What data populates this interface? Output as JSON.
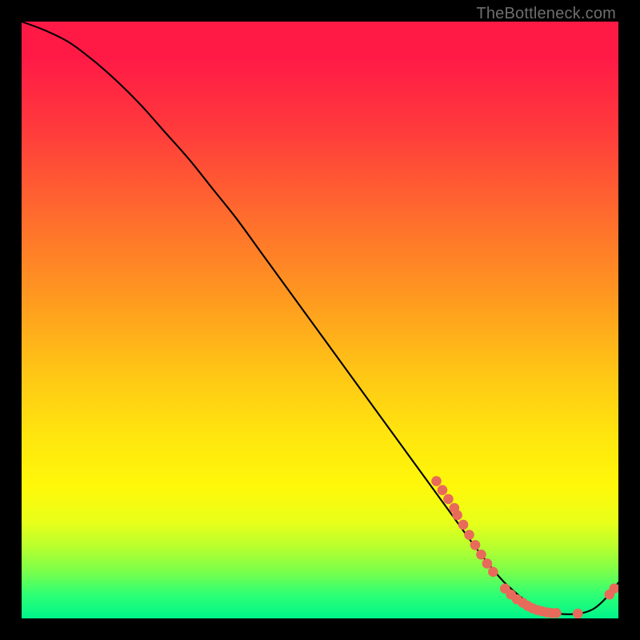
{
  "watermark": "TheBottleneck.com",
  "colors": {
    "background": "#000000",
    "curve": "#000000",
    "marker": "#e86a5a",
    "gradient_top": "#ff1a46",
    "gradient_bottom": "#00f58a"
  },
  "chart_data": {
    "type": "line",
    "title": "",
    "xlabel": "",
    "ylabel": "",
    "xlim": [
      0,
      100
    ],
    "ylim": [
      0,
      100
    ],
    "curve": {
      "x": [
        0,
        4,
        8,
        12,
        16,
        20,
        24,
        28,
        32,
        36,
        40,
        44,
        48,
        52,
        56,
        60,
        64,
        68,
        72,
        76,
        80,
        82,
        84,
        86,
        88,
        90,
        92,
        94,
        96,
        98,
        100
      ],
      "y": [
        100,
        98.5,
        96.5,
        93.5,
        90,
        86,
        81.5,
        77,
        72,
        67,
        61.5,
        56,
        50.5,
        45,
        39.5,
        34,
        28.5,
        23,
        17.5,
        12,
        7,
        5,
        3.3,
        2,
        1.2,
        0.8,
        0.7,
        0.9,
        1.7,
        3.5,
        6.0
      ]
    },
    "markers": [
      {
        "x": 69.5,
        "y": 23.0
      },
      {
        "x": 70.5,
        "y": 21.5
      },
      {
        "x": 71.5,
        "y": 20.0
      },
      {
        "x": 72.5,
        "y": 18.5
      },
      {
        "x": 73.0,
        "y": 17.3
      },
      {
        "x": 74.0,
        "y": 15.7
      },
      {
        "x": 75.0,
        "y": 14.0
      },
      {
        "x": 76.0,
        "y": 12.3
      },
      {
        "x": 77.0,
        "y": 10.7
      },
      {
        "x": 78.0,
        "y": 9.2
      },
      {
        "x": 79.0,
        "y": 7.8
      },
      {
        "x": 81.0,
        "y": 5.0
      },
      {
        "x": 82.0,
        "y": 4.0
      },
      {
        "x": 83.0,
        "y": 3.2
      },
      {
        "x": 84.0,
        "y": 2.6
      },
      {
        "x": 84.8,
        "y": 2.1
      },
      {
        "x": 85.6,
        "y": 1.7
      },
      {
        "x": 86.4,
        "y": 1.4
      },
      {
        "x": 87.2,
        "y": 1.2
      },
      {
        "x": 88.0,
        "y": 1.0
      },
      {
        "x": 88.8,
        "y": 0.9
      },
      {
        "x": 89.6,
        "y": 0.9
      },
      {
        "x": 93.2,
        "y": 0.8
      },
      {
        "x": 98.5,
        "y": 4.0
      },
      {
        "x": 99.3,
        "y": 5.0
      }
    ]
  }
}
